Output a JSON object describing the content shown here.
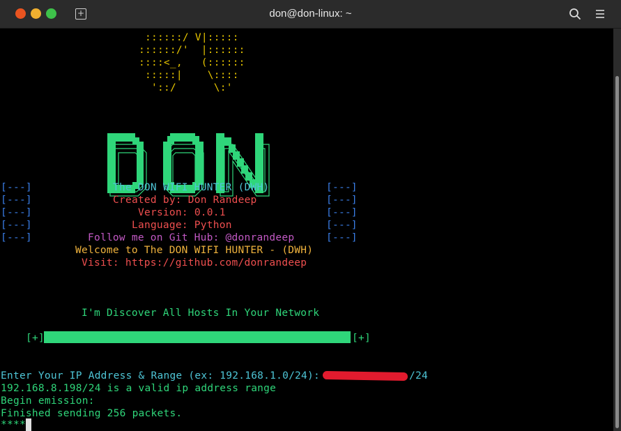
{
  "window": {
    "title": "don@don-linux: ~"
  },
  "ascii_top": [
    "::::::/ V|:::::",
    "::::::/'  |::::::",
    "::::<_,   (::::::",
    ":::::|    \\::::",
    "'::/      \\:'"
  ],
  "logo_text": "DON",
  "info_rows": [
    {
      "left": "[---]",
      "center": "The DON WIFI HUNTER (DWH)",
      "right": "[---]"
    },
    {
      "left": "[---]",
      "center": "Created by: Don Randeep",
      "right": "[---]"
    },
    {
      "left": "[---]",
      "center": "Version: 0.0.1",
      "right": "[---]"
    },
    {
      "left": "[---]",
      "center": "Language: Python",
      "right": "[---]"
    },
    {
      "left": "[---]",
      "center": "Follow me on Git Hub: @donrandeep",
      "right": "[---]"
    }
  ],
  "welcome": "Welcome to The DON WIFI HUNTER - (DWH)",
  "visit": "Visit: https://github.com/donrandeep",
  "discover": "I'm Discover All Hosts In Your Network",
  "progress": {
    "left": "[+]",
    "right": "[+]",
    "fraction": 1.0
  },
  "prompt": {
    "label": "Enter Your IP Address & Range (ex: 192.168.1.0/24):",
    "suffix": "/24"
  },
  "output": [
    "192.168.8.198/24 is a valid ip address range",
    "Begin emission:",
    "Finished sending 256 packets."
  ],
  "last_line": "****",
  "colors": {
    "title_bar": "#2b2b2b",
    "terminal_bg": "#000000",
    "green": "#2fd67a",
    "cyan": "#4ec5d6",
    "red": "#ef4f4f",
    "magenta": "#c259c4",
    "orange": "#f0b33d",
    "blue": "#3a7ee8",
    "yellow": "#e5c400"
  }
}
